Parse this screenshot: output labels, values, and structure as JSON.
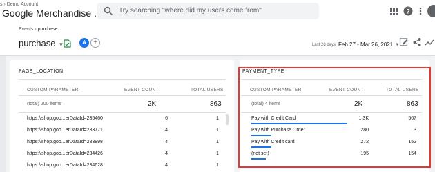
{
  "header": {
    "account_crumb": "s › Demo Account",
    "property_name": "Google Merchandise ...",
    "search_placeholder": "Try searching \"where did my users come from\""
  },
  "subheader": {
    "breadcrumb_parent": "Events",
    "breadcrumb_sep": "›",
    "breadcrumb_current": "purchase",
    "page_title": "purchase",
    "avatar_letter": "A",
    "add_symbol": "+",
    "date_label": "Last 28 days",
    "date_range": "Feb 27 - Mar 26, 2021"
  },
  "left_card": {
    "title": "PAGE_LOCATION",
    "columns": [
      "CUSTOM PARAMETER",
      "EVENT COUNT",
      "TOTAL USERS"
    ],
    "totals": {
      "label": "(total) 200 items",
      "event_count": "2K",
      "total_users": "863"
    },
    "rows": [
      {
        "name": "https://shop.goo...erDataId=235460",
        "event_count": "6",
        "total_users": "1"
      },
      {
        "name": "https://shop.goo...erDataId=233771",
        "event_count": "4",
        "total_users": "1"
      },
      {
        "name": "https://shop.goo...erDataId=233898",
        "event_count": "4",
        "total_users": "1"
      },
      {
        "name": "https://shop.goo...erDataId=234426",
        "event_count": "4",
        "total_users": "1"
      },
      {
        "name": "https://shop.goo...erDataId=234628",
        "event_count": "4",
        "total_users": "1"
      }
    ]
  },
  "right_card": {
    "title": "PAYMENT_TYPE",
    "columns": [
      "CUSTOM PARAMETER",
      "EVENT COUNT",
      "TOTAL USERS"
    ],
    "totals": {
      "label": "(total) 4 items",
      "event_count": "2K",
      "total_users": "863"
    },
    "rows": [
      {
        "name": "Pay with Credit Card",
        "event_count": "1.3K",
        "total_users": "567",
        "share": 0.66
      },
      {
        "name": "Pay with Purchase Order",
        "event_count": "280",
        "total_users": "3",
        "share": 0.14
      },
      {
        "name": "Pay with Credit card",
        "event_count": "272",
        "total_users": "152",
        "share": 0.14
      },
      {
        "name": "(not set)",
        "event_count": "195",
        "total_users": "154",
        "share": 0.1
      }
    ]
  },
  "colors": {
    "accent": "#1a73e8",
    "highlight": "#e53935"
  }
}
